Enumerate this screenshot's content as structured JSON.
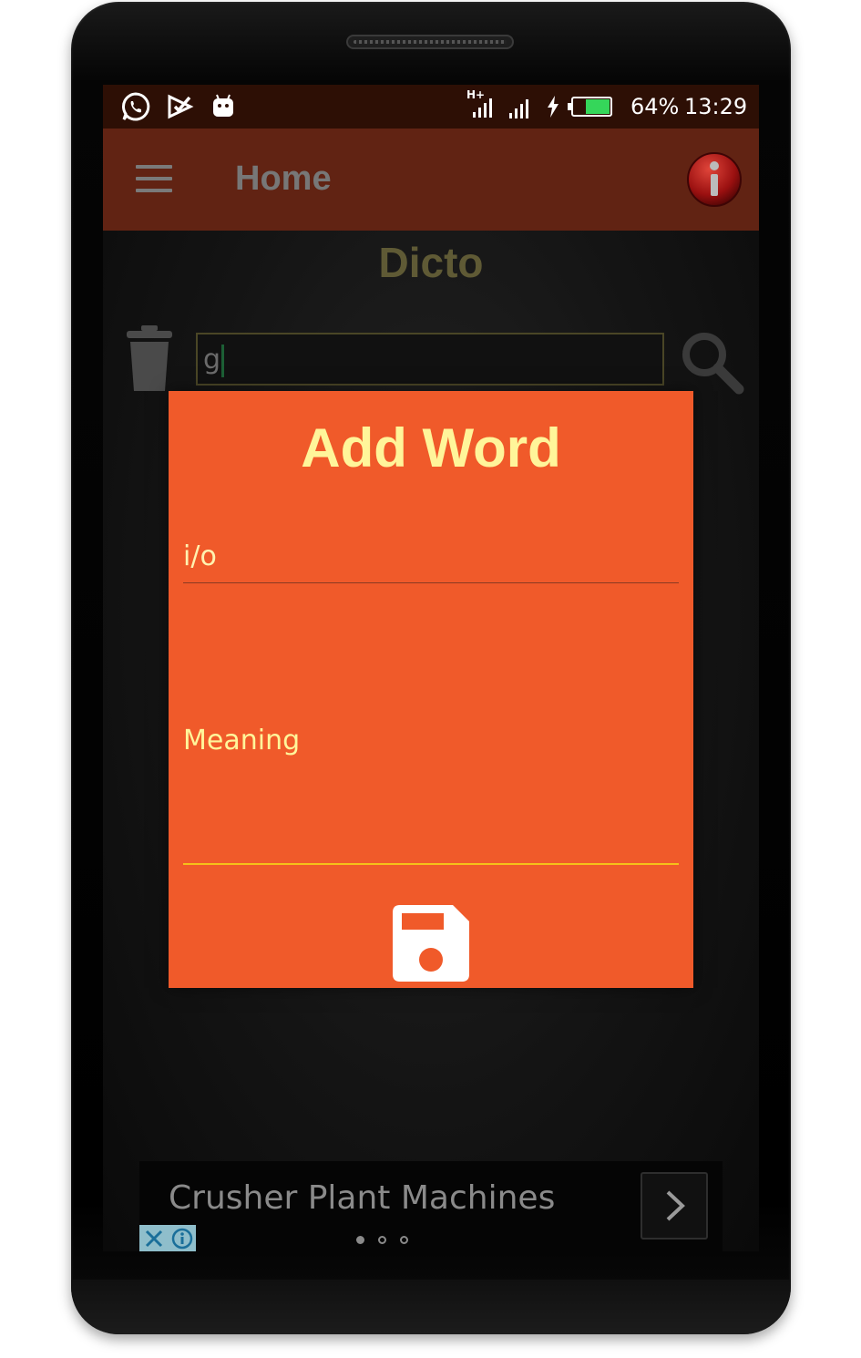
{
  "status_bar": {
    "battery_percent": "64%",
    "time": "13:29",
    "network_label": "H+",
    "icons": [
      "whatsapp-icon",
      "check-notification-icon",
      "android-icon",
      "hplus-signal-icon",
      "signal-icon",
      "charging-icon",
      "battery-icon"
    ]
  },
  "app_bar": {
    "title": "Home",
    "menu_icon": "hamburger-menu-icon",
    "info_icon": "info-icon"
  },
  "content": {
    "title": "Dicto",
    "search_value": "g",
    "trash_icon": "trash-icon",
    "search_icon": "magnifier-icon"
  },
  "dialog": {
    "title": "Add Word",
    "word_value": "i/o",
    "meaning_hint": "Meaning",
    "save_icon": "floppy-save-icon"
  },
  "ad": {
    "text": "Crusher Plant Machines",
    "next_icon": "chevron-right-icon",
    "page_dots": 3,
    "active_dot": 0
  },
  "colors": {
    "dialog_bg": "#f05a2a",
    "dialog_title": "#fff59a",
    "app_bar": "#612313",
    "status_bar": "#2d0f05",
    "meaning_underline": "#f5c11a"
  }
}
